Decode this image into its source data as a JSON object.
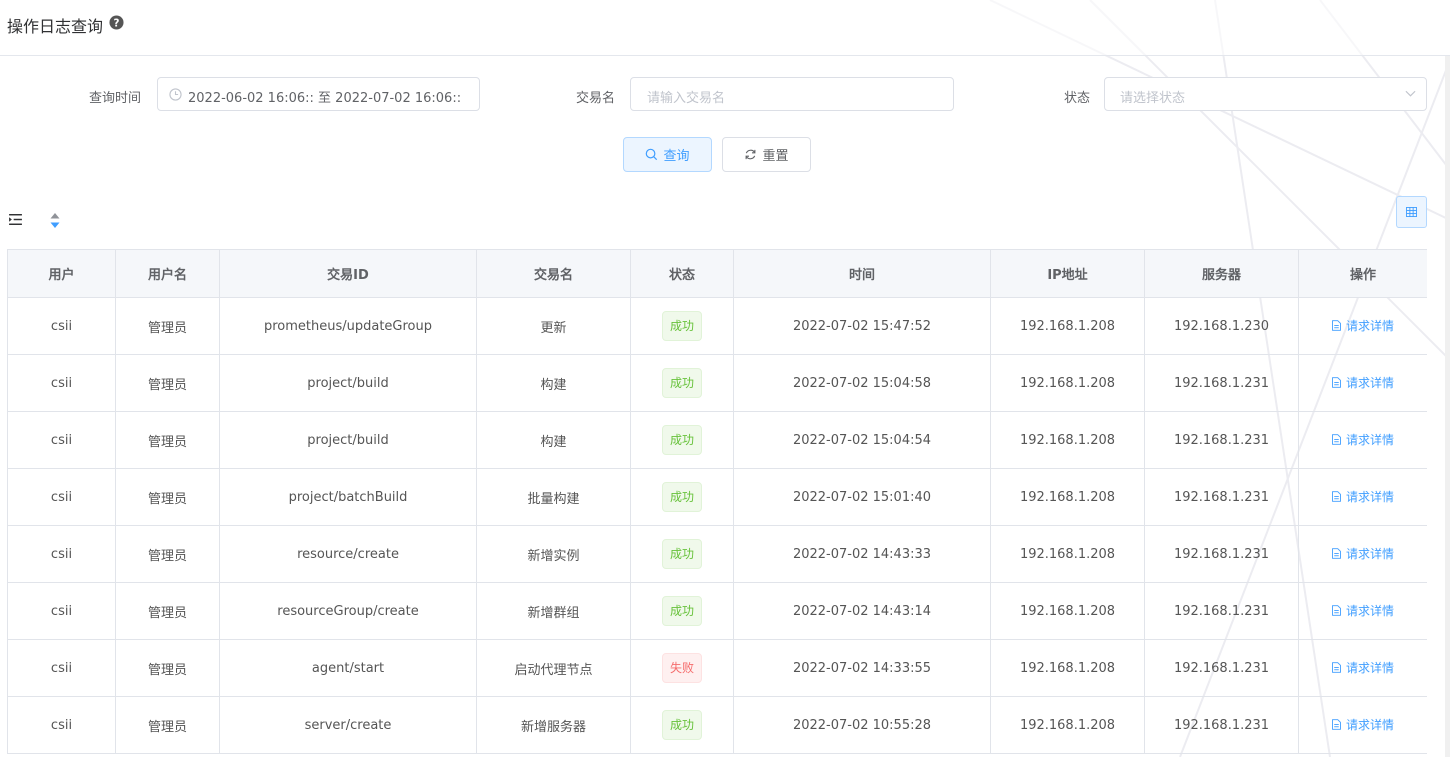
{
  "header": {
    "title": "操作日志查询"
  },
  "search": {
    "time_label": "查询时间",
    "time_value": "2022-06-02 16:06:: 至 2022-07-02 16:06::",
    "name_label": "交易名",
    "name_placeholder": "请输入交易名",
    "status_label": "状态",
    "status_placeholder": "请选择状态",
    "search_button": "查询",
    "reset_button": "重置"
  },
  "colors": {
    "accent": "#409eff",
    "success": "#67c23a",
    "danger": "#f56c6c"
  },
  "table": {
    "columns": [
      "用户",
      "用户名",
      "交易ID",
      "交易名",
      "状态",
      "时间",
      "IP地址",
      "服务器",
      "操作"
    ],
    "rows": [
      {
        "user": "csii",
        "username": "管理员",
        "trade_id": "prometheus/updateGroup",
        "trade_name": "更新",
        "status": "成功",
        "status_type": "success",
        "time": "2022-07-02 15:47:52",
        "ip": "192.168.1.208",
        "server": "192.168.1.230",
        "action": "请求详情"
      },
      {
        "user": "csii",
        "username": "管理员",
        "trade_id": "project/build",
        "trade_name": "构建",
        "status": "成功",
        "status_type": "success",
        "time": "2022-07-02 15:04:58",
        "ip": "192.168.1.208",
        "server": "192.168.1.231",
        "action": "请求详情"
      },
      {
        "user": "csii",
        "username": "管理员",
        "trade_id": "project/build",
        "trade_name": "构建",
        "status": "成功",
        "status_type": "success",
        "time": "2022-07-02 15:04:54",
        "ip": "192.168.1.208",
        "server": "192.168.1.231",
        "action": "请求详情"
      },
      {
        "user": "csii",
        "username": "管理员",
        "trade_id": "project/batchBuild",
        "trade_name": "批量构建",
        "status": "成功",
        "status_type": "success",
        "time": "2022-07-02 15:01:40",
        "ip": "192.168.1.208",
        "server": "192.168.1.231",
        "action": "请求详情"
      },
      {
        "user": "csii",
        "username": "管理员",
        "trade_id": "resource/create",
        "trade_name": "新增实例",
        "status": "成功",
        "status_type": "success",
        "time": "2022-07-02 14:43:33",
        "ip": "192.168.1.208",
        "server": "192.168.1.231",
        "action": "请求详情"
      },
      {
        "user": "csii",
        "username": "管理员",
        "trade_id": "resourceGroup/create",
        "trade_name": "新增群组",
        "status": "成功",
        "status_type": "success",
        "time": "2022-07-02 14:43:14",
        "ip": "192.168.1.208",
        "server": "192.168.1.231",
        "action": "请求详情"
      },
      {
        "user": "csii",
        "username": "管理员",
        "trade_id": "agent/start",
        "trade_name": "启动代理节点",
        "status": "失败",
        "status_type": "danger",
        "time": "2022-07-02 14:33:55",
        "ip": "192.168.1.208",
        "server": "192.168.1.231",
        "action": "请求详情"
      },
      {
        "user": "csii",
        "username": "管理员",
        "trade_id": "server/create",
        "trade_name": "新增服务器",
        "status": "成功",
        "status_type": "success",
        "time": "2022-07-02 10:55:28",
        "ip": "192.168.1.208",
        "server": "192.168.1.231",
        "action": "请求详情"
      }
    ]
  }
}
